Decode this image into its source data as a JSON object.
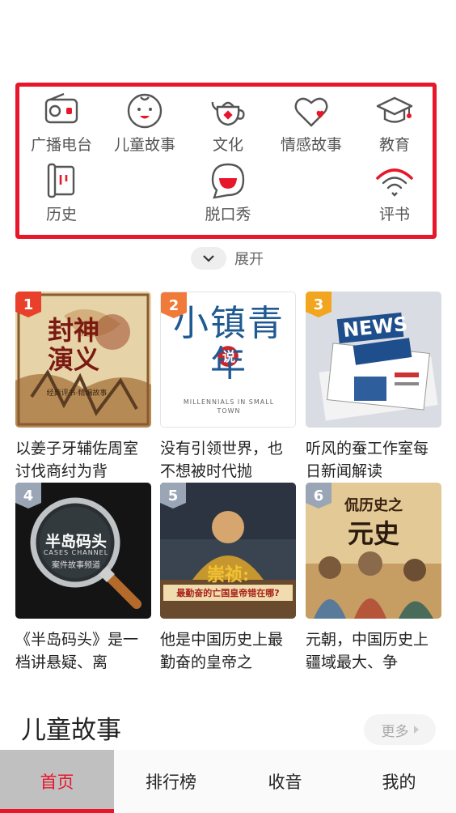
{
  "categories": [
    {
      "label": "广播电台",
      "icon": "radio-icon"
    },
    {
      "label": "儿童故事",
      "icon": "child-face-icon"
    },
    {
      "label": "文化",
      "icon": "teapot-icon"
    },
    {
      "label": "情感故事",
      "icon": "heart-icon"
    },
    {
      "label": "教育",
      "icon": "graduation-cap-icon"
    },
    {
      "label": "历史",
      "icon": "scroll-icon"
    },
    {
      "label": "脱口秀",
      "icon": "speech-bubble-icon"
    },
    {
      "label": "评书",
      "icon": "fan-icon"
    }
  ],
  "expand_label": "展开",
  "ranking": [
    {
      "rank": "1",
      "rank_color": "#e8402a",
      "desc": "以姜子牙辅佐周室讨伐商纣为背",
      "cover_title": "封神演义",
      "cover_sub": "经典评书·精编故事"
    },
    {
      "rank": "2",
      "rank_color": "#f07a3a",
      "desc": "没有引领世界，也不想被时代抛",
      "cover_title": "小镇青年",
      "cover_stamp": "说",
      "cover_sub": "MILLENNIALS IN SMALL TOWN"
    },
    {
      "rank": "3",
      "rank_color": "#f2a51e",
      "desc": "听风的蚕工作室每日新闻解读",
      "cover_title": "NEWS"
    },
    {
      "rank": "4",
      "rank_color": "#9aa5b5",
      "desc": "《半岛码头》是一档讲悬疑、离",
      "cover_title": "半岛码头",
      "cover_sub": "CASES CHANNEL",
      "cover_sub2": "案件故事频道"
    },
    {
      "rank": "5",
      "rank_color": "#9aa5b5",
      "desc": "他是中国历史上最勤奋的皇帝之",
      "cover_title": "崇祯:",
      "cover_sub": "最勤奋的亡国皇帝错在哪?"
    },
    {
      "rank": "6",
      "rank_color": "#9aa5b5",
      "desc": "元朝，中国历史上疆域最大、争",
      "cover_title": "侃历史之",
      "cover_sub": "元史"
    }
  ],
  "section": {
    "title": "儿童故事",
    "more_label": "更多"
  },
  "tabs": [
    {
      "label": "首页",
      "active": true
    },
    {
      "label": "排行榜",
      "active": false
    },
    {
      "label": "收音",
      "active": false
    },
    {
      "label": "我的",
      "active": false
    }
  ],
  "colors": {
    "accent": "#e8162b"
  }
}
